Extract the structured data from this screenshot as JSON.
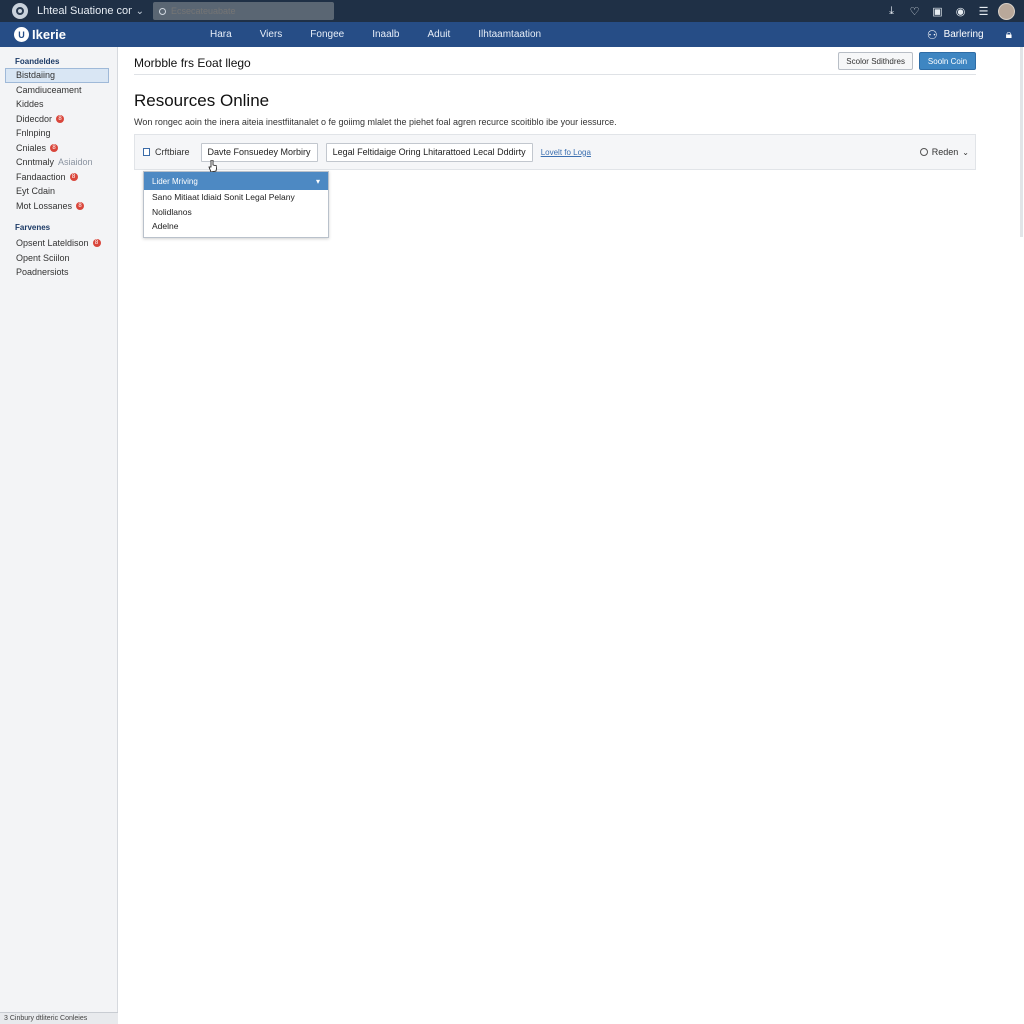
{
  "browser": {
    "tab_title": "Lhteal Suatione com",
    "search_placeholder": "Ecsecateuabate",
    "icons": [
      "download-icon",
      "heart-icon",
      "window-icon",
      "info-icon",
      "menu-icon",
      "avatar"
    ]
  },
  "app": {
    "brand": "Ikerie",
    "brand_mark": "U",
    "nav": [
      "Hara",
      "Viers",
      "Fongee",
      "Inaalb",
      "Aduit",
      "Ilhtaamtaation"
    ],
    "user_label": "Barlering"
  },
  "sidebar": {
    "section1": "Foandeldes",
    "items1": [
      {
        "label": "Bistdaiing",
        "active": true,
        "badge": ""
      },
      {
        "label": "Camdiuceament",
        "badge": ""
      },
      {
        "label": "Kiddes",
        "badge": ""
      },
      {
        "label": "Didecdor",
        "badge": "8"
      },
      {
        "label": "Fnlnping",
        "badge": ""
      },
      {
        "label": "Cniales",
        "badge": "8"
      },
      {
        "label": "Cnntmaly",
        "muted": "Asiaidon",
        "badge": ""
      },
      {
        "label": "Fandaaction",
        "badge": "8"
      },
      {
        "label": "Eyt Cdain",
        "badge": ""
      },
      {
        "label": "Mot Lossanes",
        "badge": "8"
      }
    ],
    "section2": "Farvenes",
    "items2": [
      {
        "label": "Opsent Lateldison",
        "badge": "8"
      },
      {
        "label": "Opent Sciilon",
        "badge": ""
      },
      {
        "label": "Poadnersiots",
        "badge": ""
      }
    ],
    "footer": "3 Cinbury dtliteric Conleies"
  },
  "main": {
    "header_title": "Morbble frs Eoat llego",
    "secondary_button": "Scolor Sdithdres",
    "primary_button": "Sooln Coin",
    "page_title": "Resources Online",
    "description": "Won rongec aoin the inera aiteia inestfiitanalet o fe goiimg mlalet the piehet foal agren recurce scoitiblo ibe your iessurce.",
    "filter": {
      "checkbox_label": "Crftbiare",
      "button1": "Davte Fonsuedey  Morbiry",
      "button2": "Legal Feltidaige Oring Lhitarattoed Lecal Dddirty",
      "link": "Lovelt fo Loga",
      "right_label": "Reden"
    },
    "dropdown": {
      "selected": "Lider Mriving",
      "options": [
        "Sano Mitiaat ldiaid Sonit Legal Pelany",
        "Nolidlanos",
        "Adelne"
      ]
    }
  }
}
